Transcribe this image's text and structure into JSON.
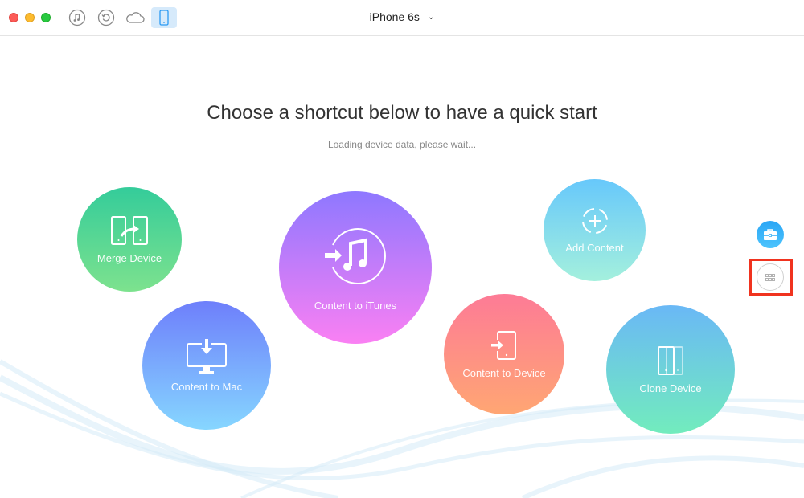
{
  "window": {
    "device_name": "iPhone 6s",
    "toolbar": [
      {
        "id": "itunes",
        "icon": "music-note-icon",
        "active": false
      },
      {
        "id": "backup",
        "icon": "restore-icon",
        "active": false
      },
      {
        "id": "icloud",
        "icon": "cloud-icon",
        "active": false
      },
      {
        "id": "device",
        "icon": "phone-icon",
        "active": true
      }
    ],
    "chevron": "⌄"
  },
  "main": {
    "heading": "Choose a shortcut below to have a quick start",
    "status": "Loading device data, please wait..."
  },
  "shortcuts": {
    "merge": {
      "label": "Merge Device",
      "icon": "merge-device-icon"
    },
    "itunes": {
      "label": "Content to iTunes",
      "icon": "itunes-transfer-icon"
    },
    "add": {
      "label": "Add Content",
      "icon": "add-content-icon"
    },
    "mac": {
      "label": "Content to Mac",
      "icon": "mac-download-icon"
    },
    "device": {
      "label": "Content to Device",
      "icon": "device-import-icon"
    },
    "clone": {
      "label": "Clone Device",
      "icon": "clone-device-icon"
    }
  },
  "side": {
    "tools_icon": "toolbox-icon",
    "more_icon": "grid-icon"
  },
  "colors": {
    "accent": "#2aa6f5",
    "highlight": "#f0331f"
  }
}
